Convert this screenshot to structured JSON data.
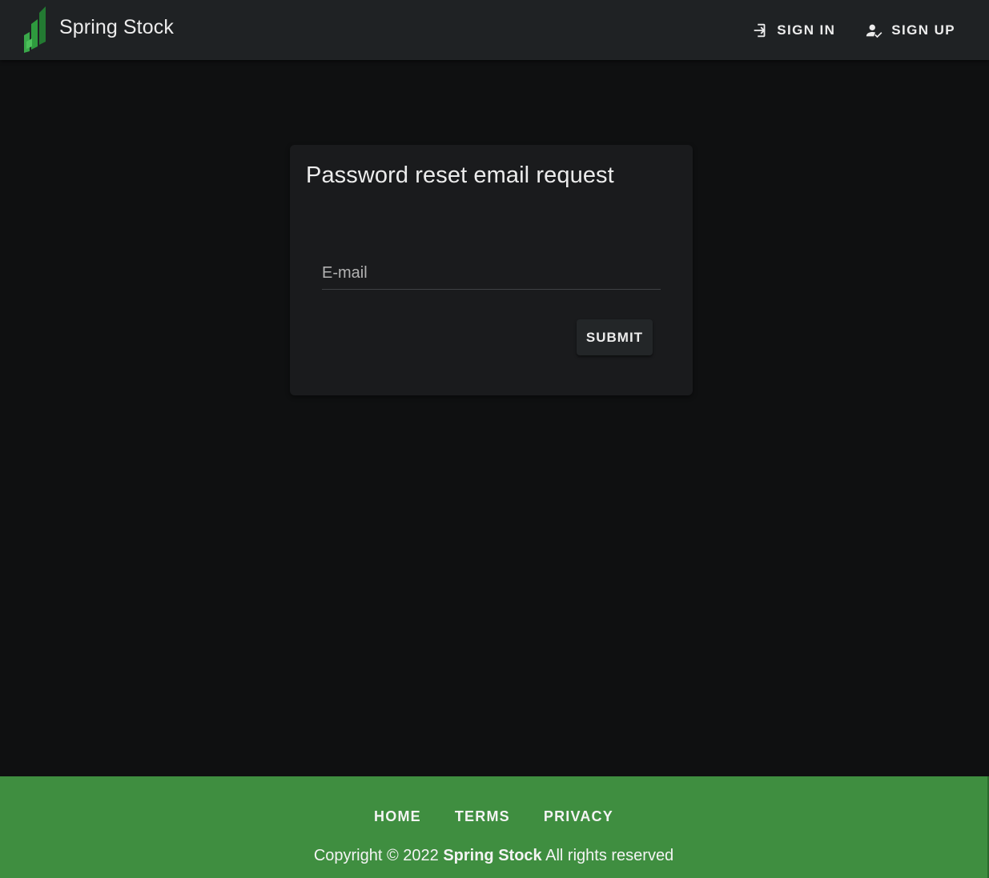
{
  "app": {
    "brand_name": "Spring Stock",
    "colors": {
      "topbar": "#1f2224",
      "background": "#0f1011",
      "card": "#1a1b1d",
      "footer": "#3f8e40",
      "logo_green": "#3aa84a"
    }
  },
  "header": {
    "logo_icon": "bar-chart-logo-icon",
    "actions": [
      {
        "label": "SIGN IN",
        "icon": "login-icon"
      },
      {
        "label": "SIGN UP",
        "icon": "account-check-icon"
      }
    ]
  },
  "card": {
    "title": "Password reset email request",
    "email_placeholder": "E-mail",
    "email_value": "",
    "submit_label": "SUBMIT"
  },
  "footer": {
    "links": [
      "HOME",
      "TERMS",
      "PRIVACY"
    ],
    "copyright_prefix": "Copyright © 2022",
    "copyright_brand": "Spring Stock",
    "copyright_suffix": "All rights reserved"
  }
}
